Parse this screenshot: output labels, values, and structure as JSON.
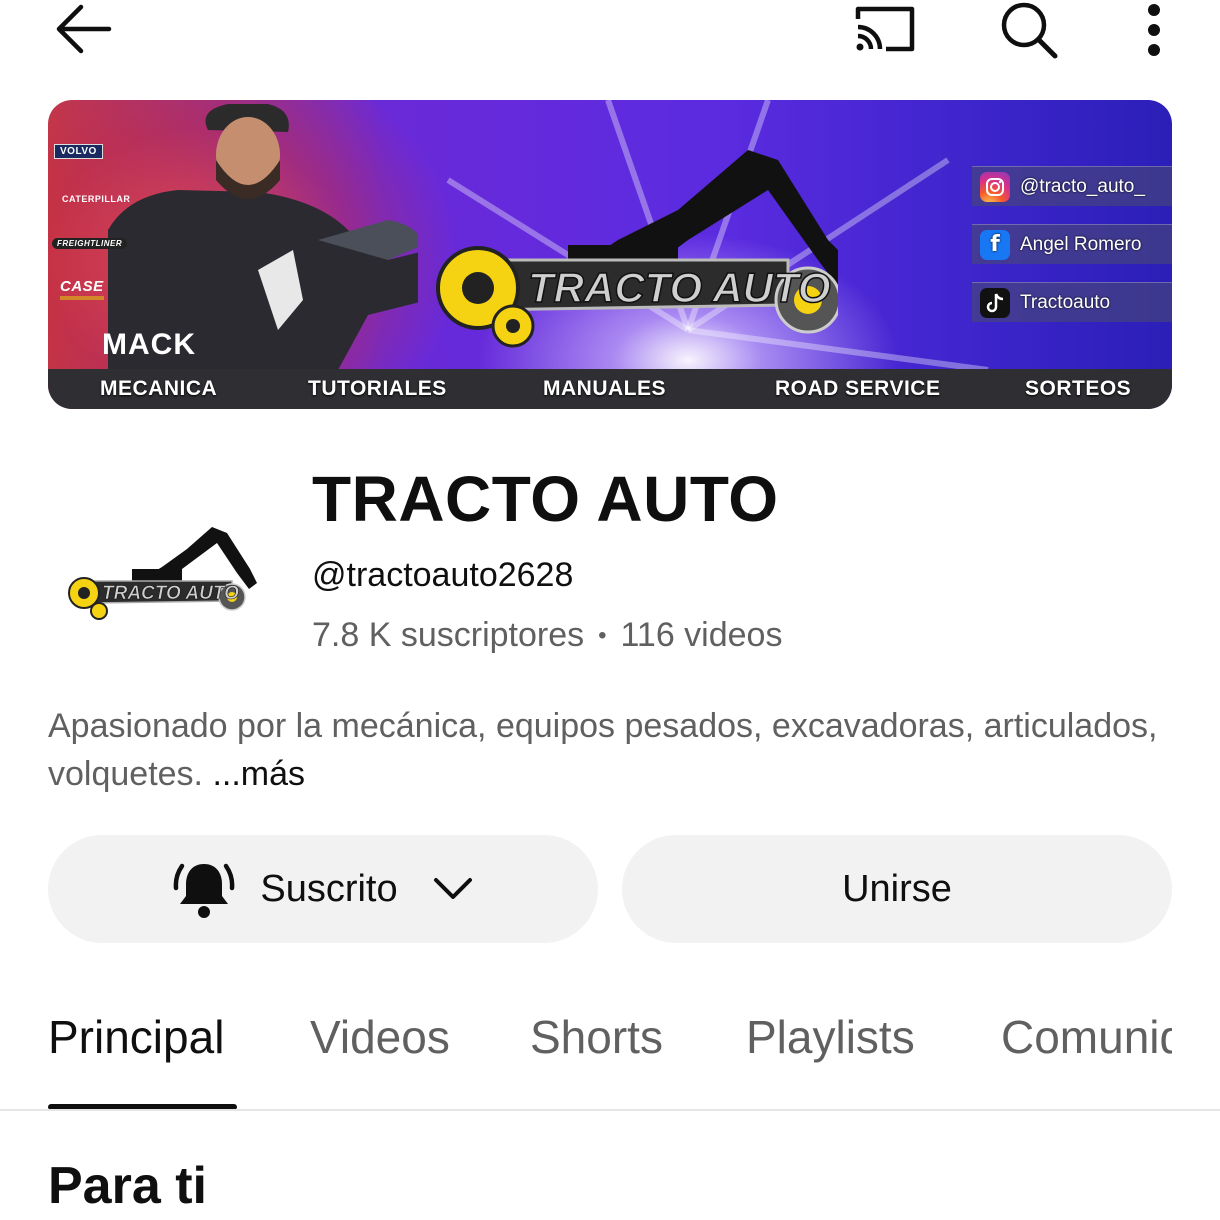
{
  "topbar": {
    "back_icon": "arrow-left-icon",
    "cast_icon": "cast-icon",
    "search_icon": "search-icon",
    "more_icon": "more-vertical-icon"
  },
  "banner": {
    "brands": [
      "VOLVO",
      "CATERPILLAR",
      "FREIGHTLINER",
      "CASE",
      "MACK"
    ],
    "logo_text": "TRACTO AUTO",
    "socials": [
      {
        "icon": "instagram-icon",
        "label": "@tracto_auto_"
      },
      {
        "icon": "facebook-icon",
        "label": "Angel Romero"
      },
      {
        "icon": "tiktok-icon",
        "label": "Tractoauto"
      }
    ],
    "nav": [
      "MECANICA",
      "TUTORIALES",
      "MANUALES",
      "ROAD SERVICE",
      "SORTEOS"
    ]
  },
  "channel": {
    "title": "TRACTO AUTO",
    "handle": "@tractoauto2628",
    "subscribers": "7.8 K suscriptores",
    "separator": "•",
    "videos": "116 videos",
    "avatar_text": "TRACTO AUTO"
  },
  "description": {
    "text": "Apasionado por la mecánica, equipos pesados, excavadoras, articulados, volquetes.",
    "more_label": "...más"
  },
  "actions": {
    "subscribed_label": "Suscrito",
    "join_label": "Unirse"
  },
  "tabs": [
    {
      "label": "Principal",
      "active": true
    },
    {
      "label": "Videos",
      "active": false
    },
    {
      "label": "Shorts",
      "active": false
    },
    {
      "label": "Playlists",
      "active": false
    },
    {
      "label": "Comunidad",
      "active": false
    }
  ],
  "section": {
    "title": "Para ti"
  },
  "colors": {
    "text_primary": "#0f0f0f",
    "text_secondary": "#606060",
    "button_bg": "#f2f2f2",
    "logo_yellow": "#f5d312"
  }
}
